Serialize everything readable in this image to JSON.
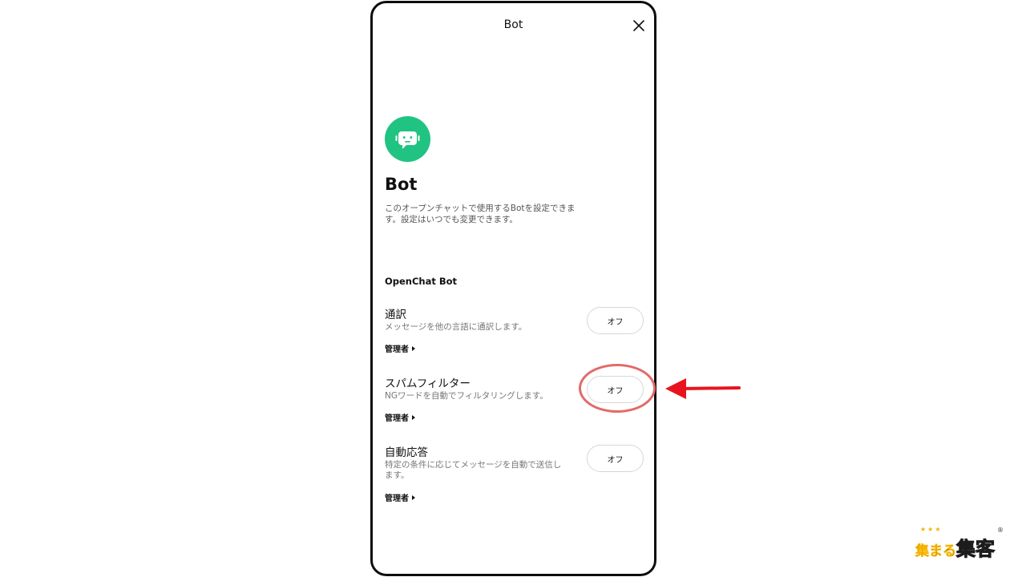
{
  "header": {
    "title": "Bot",
    "close_icon": "close-icon"
  },
  "intro": {
    "avatar_icon": "bot-face-icon",
    "avatar_color": "#21c382",
    "heading": "Bot",
    "description_line1": "このオープンチャットで使用するBotを設定できま",
    "description_line2": "す。設定はいつでも変更できます。"
  },
  "section": {
    "title": "OpenChat Bot"
  },
  "bots": [
    {
      "name": "通訳",
      "desc_line1": "メッセージを他の言語に通訳します。",
      "desc_line2": "",
      "admin_label": "管理者",
      "toggle_label": "オフ"
    },
    {
      "name": "スパムフィルター",
      "desc_line1": "NGワードを自動でフィルタリングします。",
      "desc_line2": "",
      "admin_label": "管理者",
      "toggle_label": "オフ"
    },
    {
      "name": "自動応答",
      "desc_line1": "特定の条件に応じてメッセージを自動で送信し",
      "desc_line2": "ます。",
      "admin_label": "管理者",
      "toggle_label": "オフ"
    }
  ],
  "annotation": {
    "ring_color": "#e36a6a",
    "arrow_color": "#e8141d"
  },
  "logo": {
    "stars": "★★★",
    "text_a": "集まる",
    "text_b": "集客",
    "reg": "®"
  }
}
